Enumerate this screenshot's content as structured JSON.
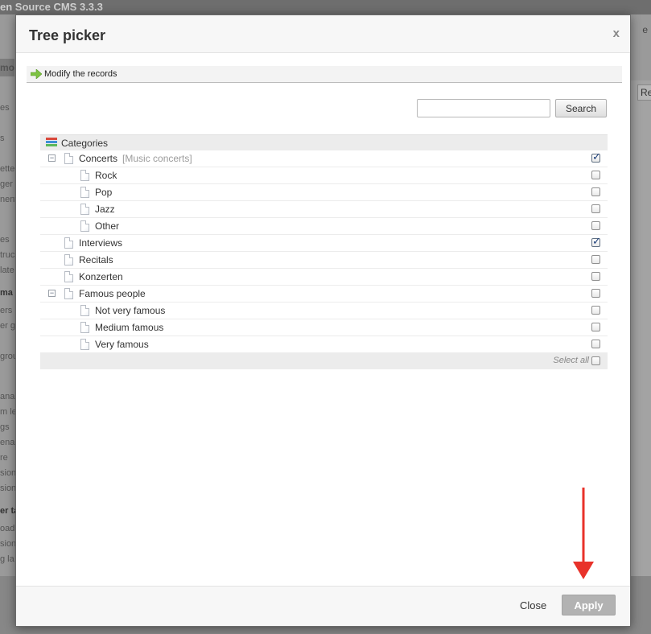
{
  "background": {
    "app_title": "en Source CMS 3.3.3",
    "top_right_text": "e",
    "sub_bar_text": "mo",
    "right_button": "Re",
    "side_items": [
      "es",
      "s",
      "ette",
      "ger",
      "nent",
      "es",
      "truc",
      "late",
      "ma",
      "ers",
      "er g",
      "grou",
      "ana",
      "m le",
      "gs",
      "ena",
      "re",
      "sion",
      "sion",
      "er ta",
      "oad",
      "sion",
      "g la"
    ]
  },
  "modal": {
    "title": "Tree picker",
    "close_icon_label": "x",
    "breadcrumb": "Modify the records",
    "search": {
      "value": "",
      "placeholder": "",
      "button_label": "Search"
    },
    "tree": {
      "header_label": "Categories",
      "rows": [
        {
          "label": "Concerts",
          "note": "[Music concerts]",
          "level": 0,
          "expandable": true,
          "checked": true
        },
        {
          "label": "Rock",
          "note": "",
          "level": 1,
          "expandable": false,
          "checked": false
        },
        {
          "label": "Pop",
          "note": "",
          "level": 1,
          "expandable": false,
          "checked": false
        },
        {
          "label": "Jazz",
          "note": "",
          "level": 1,
          "expandable": false,
          "checked": false
        },
        {
          "label": "Other",
          "note": "",
          "level": 1,
          "expandable": false,
          "checked": false
        },
        {
          "label": "Interviews",
          "note": "",
          "level": 0,
          "expandable": false,
          "checked": true
        },
        {
          "label": "Recitals",
          "note": "",
          "level": 0,
          "expandable": false,
          "checked": false
        },
        {
          "label": "Konzerten",
          "note": "",
          "level": 0,
          "expandable": false,
          "checked": false
        },
        {
          "label": "Famous people",
          "note": "",
          "level": 0,
          "expandable": true,
          "checked": false
        },
        {
          "label": "Not very famous",
          "note": "",
          "level": 1,
          "expandable": false,
          "checked": false
        },
        {
          "label": "Medium famous",
          "note": "",
          "level": 1,
          "expandable": false,
          "checked": false
        },
        {
          "label": "Very famous",
          "note": "",
          "level": 1,
          "expandable": false,
          "checked": false
        }
      ],
      "select_all_label": "Select all",
      "select_all_checked": false
    },
    "footer": {
      "close_label": "Close",
      "apply_label": "Apply"
    }
  },
  "colors": {
    "annotation_arrow": "#e8322a",
    "breadcrumb_arrow": "#7dc242",
    "apply_button_bg": "#b2b2b2",
    "checkmark": "#1c3f7a"
  },
  "icons": {
    "modal_close": "close-icon",
    "breadcrumb": "green-arrow-icon",
    "categories": "categories-icon",
    "tree_toggle": "collapse-icon",
    "tree_item": "page-icon",
    "annotation": "red-down-arrow-icon"
  }
}
